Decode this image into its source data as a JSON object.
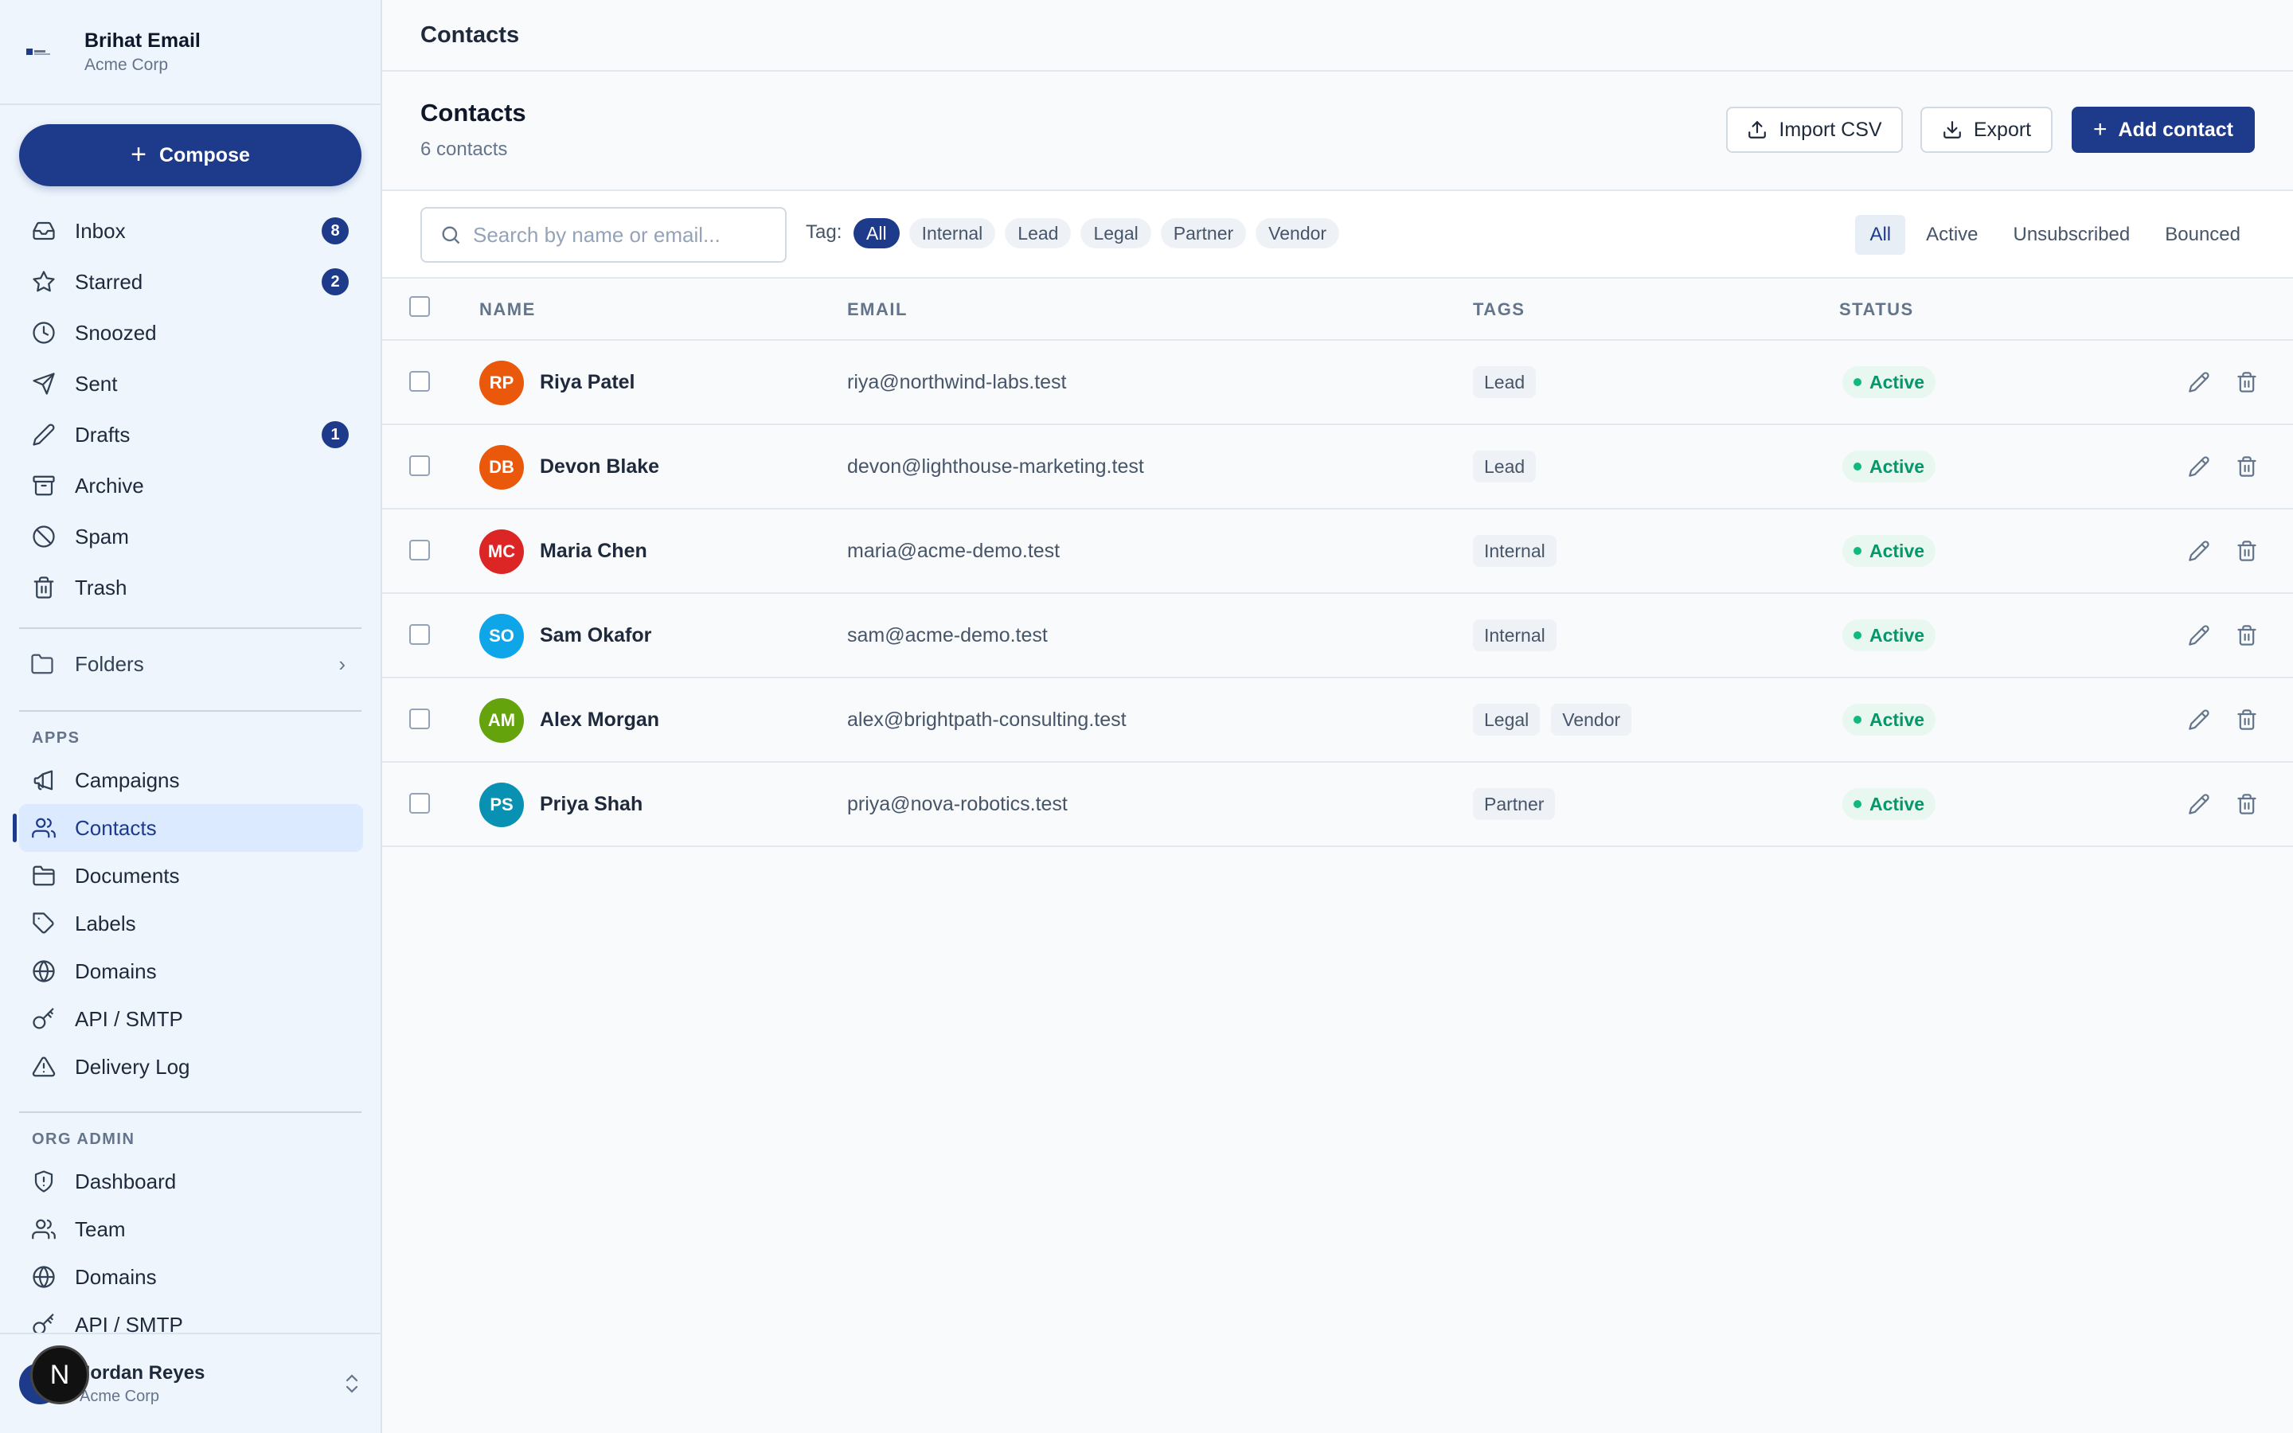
{
  "brand": {
    "name": "Brihat Email",
    "org": "Acme Corp"
  },
  "compose": {
    "label": "Compose"
  },
  "nav": [
    {
      "label": "Inbox",
      "icon": "inbox-icon",
      "badge": "8"
    },
    {
      "label": "Starred",
      "icon": "star-icon",
      "badge": "2"
    },
    {
      "label": "Snoozed",
      "icon": "clock-icon",
      "badge": ""
    },
    {
      "label": "Sent",
      "icon": "send-icon",
      "badge": ""
    },
    {
      "label": "Drafts",
      "icon": "pencil-icon",
      "badge": "1"
    },
    {
      "label": "Archive",
      "icon": "archive-icon",
      "badge": ""
    },
    {
      "label": "Spam",
      "icon": "ban-icon",
      "badge": ""
    },
    {
      "label": "Trash",
      "icon": "trash-icon",
      "badge": ""
    }
  ],
  "folders": {
    "label": "Folders"
  },
  "apps": {
    "heading": "APPS",
    "items": [
      {
        "label": "Campaigns",
        "icon": "megaphone-icon"
      },
      {
        "label": "Contacts",
        "icon": "users-icon",
        "active": true
      },
      {
        "label": "Documents",
        "icon": "folder-icon"
      },
      {
        "label": "Labels",
        "icon": "tag-icon"
      },
      {
        "label": "Domains",
        "icon": "globe-icon"
      },
      {
        "label": "API / SMTP",
        "icon": "key-icon"
      },
      {
        "label": "Delivery Log",
        "icon": "alert-icon"
      }
    ]
  },
  "org_admin": {
    "heading": "ORG ADMIN",
    "items": [
      {
        "label": "Dashboard",
        "icon": "shield-icon"
      },
      {
        "label": "Team",
        "icon": "users-icon"
      },
      {
        "label": "Domains",
        "icon": "globe-icon"
      },
      {
        "label": "API / SMTP",
        "icon": "key-icon"
      }
    ]
  },
  "user": {
    "name": "Jordan Reyes",
    "org": "Acme Corp",
    "initials": "J",
    "overlay": "N"
  },
  "topbar": {
    "title": "Contacts"
  },
  "page": {
    "title": "Contacts",
    "subtitle": "6 contacts",
    "import_label": "Import CSV",
    "export_label": "Export",
    "add_label": "Add contact"
  },
  "search": {
    "placeholder": "Search by name or email...",
    "value": ""
  },
  "tag_filter": {
    "label": "Tag:",
    "options": [
      "All",
      "Internal",
      "Lead",
      "Legal",
      "Partner",
      "Vendor"
    ],
    "selected": "All"
  },
  "status_filter": {
    "options": [
      "All",
      "Active",
      "Unsubscribed",
      "Bounced"
    ],
    "selected": "All"
  },
  "table": {
    "columns": {
      "name": "NAME",
      "email": "EMAIL",
      "tags": "TAGS",
      "status": "STATUS"
    },
    "rows": [
      {
        "initials": "RP",
        "name": "Riya Patel",
        "email": "riya@northwind-labs.test",
        "tags": [
          "Lead"
        ],
        "status": "Active",
        "color": "#ea580c"
      },
      {
        "initials": "DB",
        "name": "Devon Blake",
        "email": "devon@lighthouse-marketing.test",
        "tags": [
          "Lead"
        ],
        "status": "Active",
        "color": "#ea580c"
      },
      {
        "initials": "MC",
        "name": "Maria Chen",
        "email": "maria@acme-demo.test",
        "tags": [
          "Internal"
        ],
        "status": "Active",
        "color": "#dc2626"
      },
      {
        "initials": "SO",
        "name": "Sam Okafor",
        "email": "sam@acme-demo.test",
        "tags": [
          "Internal"
        ],
        "status": "Active",
        "color": "#0ea5e9"
      },
      {
        "initials": "AM",
        "name": "Alex Morgan",
        "email": "alex@brightpath-consulting.test",
        "tags": [
          "Legal",
          "Vendor"
        ],
        "status": "Active",
        "color": "#65a30d"
      },
      {
        "initials": "PS",
        "name": "Priya Shah",
        "email": "priya@nova-robotics.test",
        "tags": [
          "Partner"
        ],
        "status": "Active",
        "color": "#0891b2"
      }
    ]
  },
  "colors": {
    "primary": "#1e3a8a",
    "active_status": "#059669",
    "sidebar_bg": "#eef5fc"
  }
}
